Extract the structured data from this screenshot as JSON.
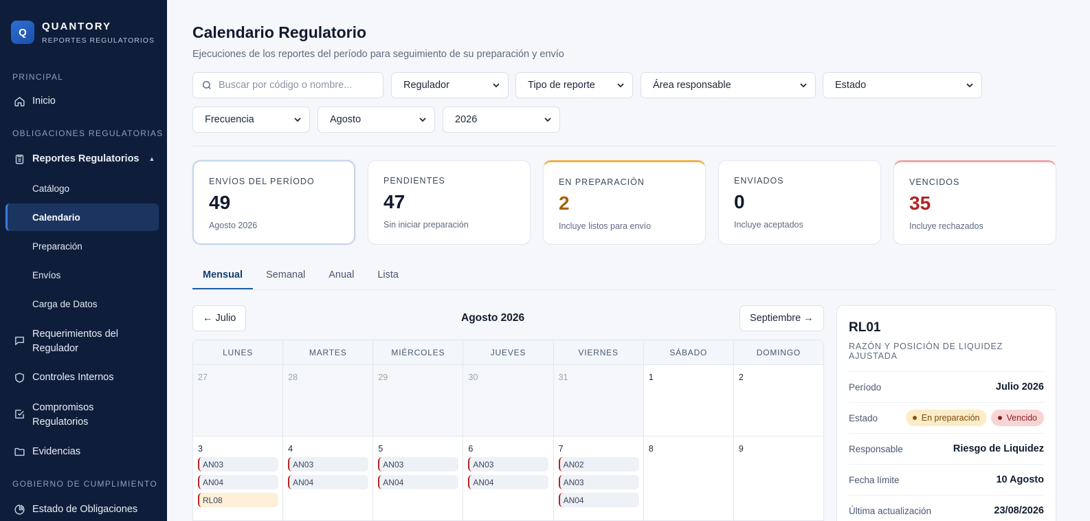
{
  "brand": {
    "logo_letter": "Q",
    "name": "QUANTORY",
    "subtitle": "REPORTES REGULATORIOS"
  },
  "sidebar": {
    "sections": [
      "PRINCIPAL",
      "OBLIGACIONES REGULATORIAS",
      "GOBIERNO DE CUMPLIMIENTO"
    ],
    "inicio": "Inicio",
    "reportes": "Reportes Regulatorios",
    "sub_items": [
      "Catálogo",
      "Calendario",
      "Preparación",
      "Envíos",
      "Carga de Datos"
    ],
    "req_line1": "Requerimientos del",
    "req_line2": "Regulador",
    "controles": "Controles Internos",
    "comp_line1": "Compromisos",
    "comp_line2": "Regulatorios",
    "evidencias": "Evidencias",
    "estado": "Estado de Obligaciones"
  },
  "header": {
    "title": "Calendario Regulatorio",
    "subtitle": "Ejecuciones de los reportes del período para seguimiento de su preparación y envío"
  },
  "filters": {
    "search_placeholder": "Buscar por código o nombre...",
    "regulador": "Regulador",
    "tipo": "Tipo de reporte",
    "area": "Área responsable",
    "estado": "Estado",
    "frecuencia": "Frecuencia",
    "mes": "Agosto",
    "anio": "2026"
  },
  "kpis": [
    {
      "label": "ENVÍOS DEL PERÍODO",
      "value": "49",
      "sub": "Agosto 2026"
    },
    {
      "label": "PENDIENTES",
      "value": "47",
      "sub": "Sin iniciar preparación"
    },
    {
      "label": "EN PREPARACIÓN",
      "value": "2",
      "sub": "Incluye listos para envío"
    },
    {
      "label": "ENVIADOS",
      "value": "0",
      "sub": "Incluye aceptados"
    },
    {
      "label": "VENCIDOS",
      "value": "35",
      "sub": "Incluye rechazados"
    }
  ],
  "tabs": [
    "Mensual",
    "Semanal",
    "Anual",
    "Lista"
  ],
  "calendar": {
    "prev": "← Julio",
    "next": "Septiembre →",
    "title": "Agosto 2026",
    "weekdays": [
      "LUNES",
      "MARTES",
      "MIÉRCOLES",
      "JUEVES",
      "VIERNES",
      "SÁBADO",
      "DOMINGO"
    ],
    "week1": [
      "27",
      "28",
      "29",
      "30",
      "31",
      "1",
      "2"
    ],
    "week2": [
      {
        "day": "3",
        "chips": [
          "AN03",
          "AN04",
          "RL08"
        ]
      },
      {
        "day": "4",
        "chips": [
          "AN03",
          "AN04"
        ]
      },
      {
        "day": "5",
        "chips": [
          "AN03",
          "AN04"
        ]
      },
      {
        "day": "6",
        "chips": [
          "AN03",
          "AN04"
        ]
      },
      {
        "day": "7",
        "chips": [
          "AN02",
          "AN03",
          "AN04"
        ]
      },
      {
        "day": "8",
        "chips": []
      },
      {
        "day": "9",
        "chips": []
      }
    ]
  },
  "detail": {
    "code": "RL01",
    "name": "RAZÓN Y POSICIÓN DE LIQUIDEZ AJUSTADA",
    "periodo_label": "Período",
    "periodo_value": "Julio 2026",
    "estado_label": "Estado",
    "badge_prep": "En preparación",
    "badge_venc": "Vencido",
    "resp_label": "Responsable",
    "resp_value": "Riesgo de Liquidez",
    "fecha_label": "Fecha límite",
    "fecha_value": "10 Agosto",
    "upd_label": "Última actualización",
    "upd_value": "23/08/2026"
  },
  "colors": {
    "sidebar_bg": "#0e1e3a",
    "accent": "#1f5fa8",
    "amber": "#a8600e",
    "red": "#b42323"
  }
}
